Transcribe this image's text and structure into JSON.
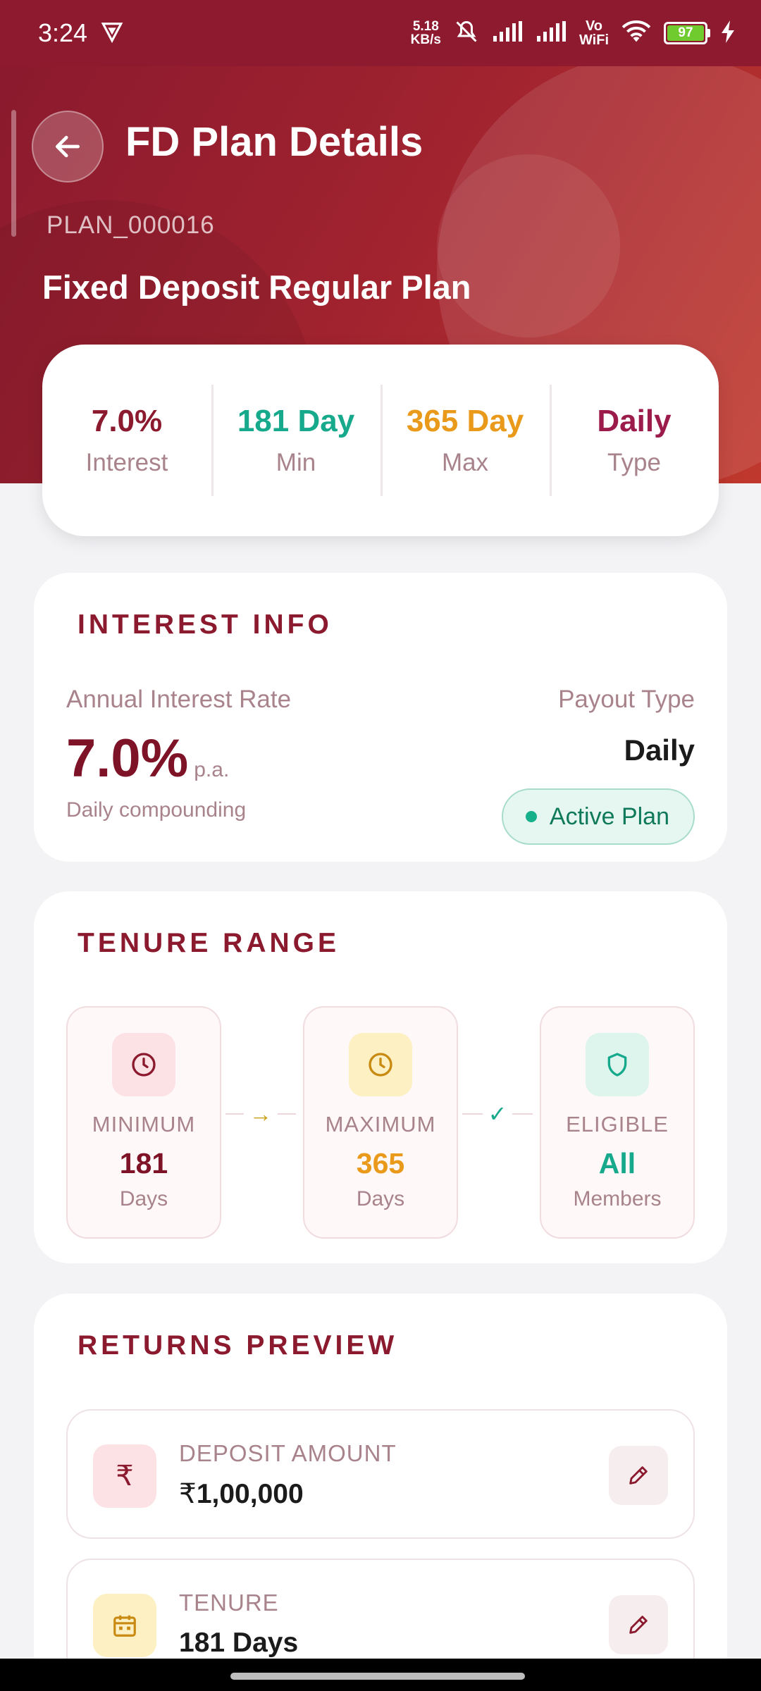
{
  "status_bar": {
    "time": "3:24",
    "net_speed": "5.18",
    "net_unit": "KB/s",
    "vowifi_top": "Vo",
    "vowifi_bottom": "WiFi",
    "battery": "97"
  },
  "header": {
    "title": "FD Plan Details",
    "plan_id": "PLAN_000016",
    "plan_name": "Fixed Deposit Regular Plan"
  },
  "summary": [
    {
      "value": "7.0%",
      "label": "Interest",
      "color": "#8B1A2E"
    },
    {
      "value": "181 Day",
      "label": "Min",
      "color": "#16A98B"
    },
    {
      "value": "365 Day",
      "label": "Max",
      "color": "#E99A1A"
    },
    {
      "value": "Daily",
      "label": "Type",
      "color": "#9B1B4A"
    }
  ],
  "interest_info": {
    "title": "INTEREST INFO",
    "rate_label": "Annual Interest Rate",
    "rate": "7.0%",
    "rate_unit": "p.a.",
    "compounding": "Daily compounding",
    "payout_label": "Payout Type",
    "payout_value": "Daily",
    "status_badge": "Active Plan"
  },
  "tenure_range": {
    "title": "TENURE RANGE",
    "boxes": [
      {
        "label": "MINIMUM",
        "value": "181",
        "unit": "Days",
        "color": "#7E1327"
      },
      {
        "label": "MAXIMUM",
        "value": "365",
        "unit": "Days",
        "color": "#E99A1A"
      },
      {
        "label": "ELIGIBLE",
        "value": "All",
        "unit": "Members",
        "color": "#16A98B"
      }
    ],
    "connector_1": "→",
    "connector_2": "✓"
  },
  "returns_preview": {
    "title": "RETURNS PREVIEW",
    "rows": [
      {
        "label": "DEPOSIT AMOUNT",
        "currency": "₹",
        "value": "1,00,000",
        "icon": "rupee-icon"
      },
      {
        "label": "TENURE",
        "value": "181 Days",
        "icon": "calendar-icon"
      }
    ]
  }
}
